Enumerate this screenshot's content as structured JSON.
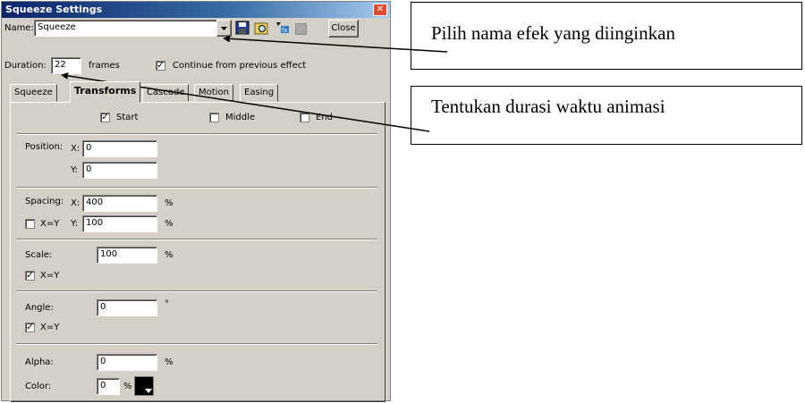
{
  "window": {
    "title": "Squeeze Settings",
    "close_glyph": "✕"
  },
  "name_row": {
    "label": "Name:",
    "value": "Squeeze",
    "close_button": "Close"
  },
  "duration_row": {
    "label": "Duration:",
    "value": "22",
    "unit": "frames",
    "continue_label": "Continue from previous effect",
    "continue_checked": true
  },
  "tabs": [
    "Squeeze",
    "Transforms",
    "Cascade",
    "Motion",
    "Easing"
  ],
  "active_tab": "Transforms",
  "phases": [
    {
      "label": "Start",
      "checked": true
    },
    {
      "label": "Middle",
      "checked": false
    },
    {
      "label": "End",
      "checked": false
    }
  ],
  "position": {
    "label": "Position:",
    "x_label": "X:",
    "x": "0",
    "y_label": "Y:",
    "y": "0"
  },
  "spacing": {
    "label": "Spacing:",
    "x_label": "X:",
    "x": "400",
    "y_label": "Y:",
    "y": "100",
    "unit": "%",
    "xeqy_label": "X=Y",
    "xeqy_checked": false
  },
  "scale": {
    "label": "Scale:",
    "value": "100",
    "unit": "%",
    "xeqy_label": "X=Y",
    "xeqy_checked": true
  },
  "angle": {
    "label": "Angle:",
    "value": "0",
    "unit": "°",
    "xeqy_label": "X=Y",
    "xeqy_checked": true
  },
  "alpha": {
    "label": "Alpha:",
    "value": "0",
    "unit": "%"
  },
  "color": {
    "label": "Color:",
    "value": "0",
    "unit": "%",
    "swatch": "#000000"
  },
  "callouts": {
    "name": "Pilih nama efek yang diinginkan",
    "duration": "Tentukan durasi waktu animasi"
  }
}
